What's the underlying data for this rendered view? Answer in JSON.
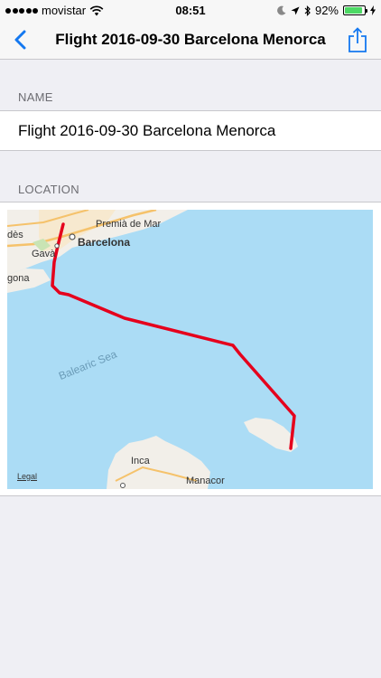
{
  "status_bar": {
    "carrier": "movistar",
    "time": "08:51",
    "battery": "92%",
    "battery_level": 0.92
  },
  "nav": {
    "title": "Flight 2016-09-30 Barcelona Menorca"
  },
  "sections": {
    "name_header": "NAME",
    "name_value": "Flight 2016-09-30 Barcelona Menorca",
    "location_header": "LOCATION"
  },
  "map": {
    "labels": {
      "premia": "Premià de Mar",
      "barcelona": "Barcelona",
      "gava": "Gavà",
      "des": "dès",
      "gona": "gona",
      "sea": "Balearic Sea",
      "inca": "Inca",
      "manacor": "Manacor"
    },
    "legal": "Legal",
    "colors": {
      "water": "#abdcf5",
      "land": "#f2efe9",
      "route": "#e5001c"
    }
  }
}
